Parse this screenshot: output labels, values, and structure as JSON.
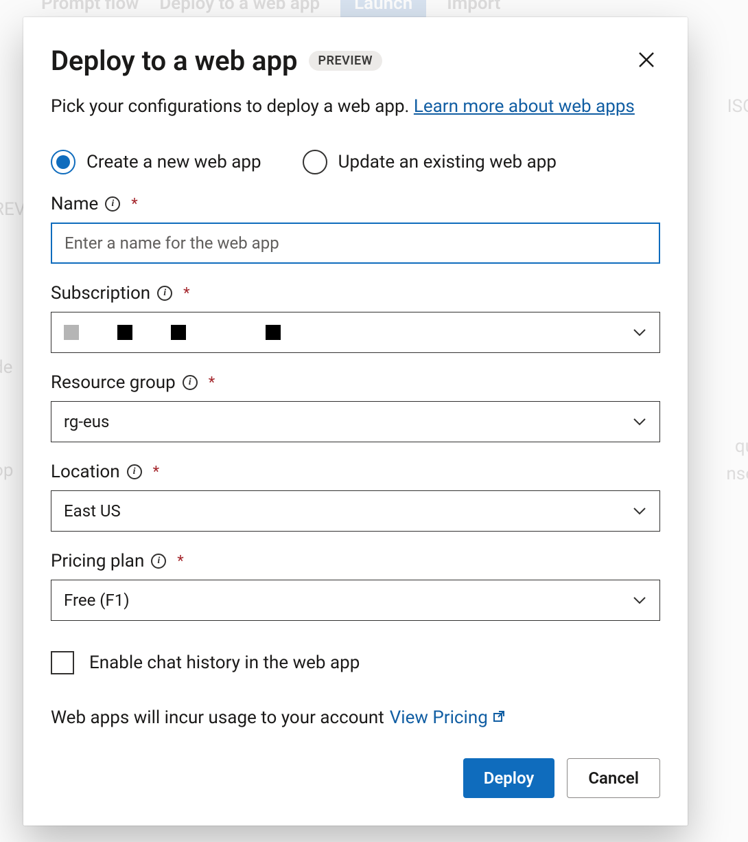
{
  "background": {
    "menu": {
      "prompt_flow": "Prompt flow",
      "deploy": "Deploy to a web app",
      "launch": "Launch",
      "import": "Import"
    },
    "left_fragments": {
      "revi": "REVI",
      "de": "de",
      "op": "op"
    },
    "right_fragments": {
      "iso": "ISO",
      "qu": "qu",
      "nse": "nse"
    }
  },
  "dialog": {
    "title": "Deploy to a web app",
    "badge": "PREVIEW",
    "subtitle_prefix": "Pick your configurations to deploy a web app. ",
    "learn_more": "Learn more about web apps",
    "radios": {
      "create": "Create a new web app",
      "update": "Update an existing web app",
      "selected": "create"
    },
    "fields": {
      "name": {
        "label": "Name",
        "placeholder": "Enter a name for the web app",
        "value": ""
      },
      "subscription": {
        "label": "Subscription",
        "value_redacted": true
      },
      "resource_group": {
        "label": "Resource group",
        "value": "rg-eus"
      },
      "location": {
        "label": "Location",
        "value": "East US"
      },
      "pricing_plan": {
        "label": "Pricing plan",
        "value": "Free (F1)"
      }
    },
    "checkbox": {
      "label": "Enable chat history in the web app",
      "checked": false
    },
    "usage_note_prefix": "Web apps will incur usage to your account ",
    "view_pricing": "View Pricing",
    "buttons": {
      "deploy": "Deploy",
      "cancel": "Cancel"
    }
  }
}
